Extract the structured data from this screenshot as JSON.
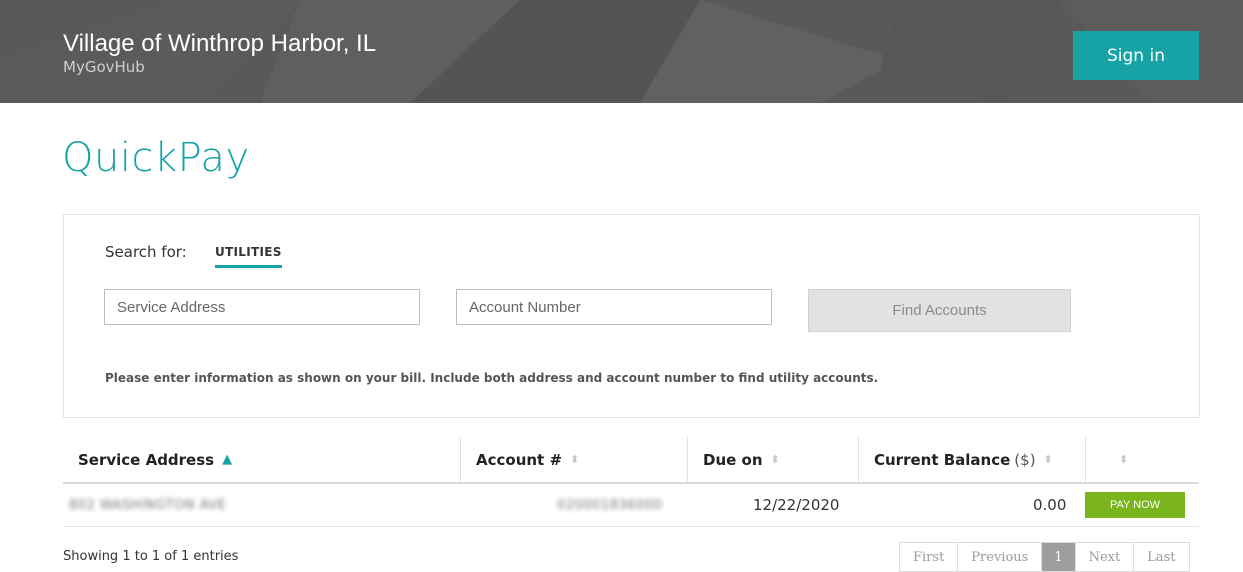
{
  "header": {
    "title": "Village of Winthrop Harbor, IL",
    "subtitle": "MyGovHub",
    "signin_label": "Sign in"
  },
  "page": {
    "title": "QuickPay"
  },
  "search": {
    "search_for_label": "Search for:",
    "tab_label": "UTILITIES",
    "address_placeholder": "Service Address",
    "account_placeholder": "Account Number",
    "find_label": "Find Accounts",
    "hint": "Please enter information as shown on your bill. Include both address and account number to find utility accounts."
  },
  "table": {
    "columns": {
      "address": "Service Address",
      "account": "Account #",
      "due": "Due on",
      "balance": "Current Balance",
      "balance_unit": "($)"
    },
    "rows": [
      {
        "address": "802 WASHINGTON AVE",
        "account": "020001836000",
        "due": "12/22/2020",
        "balance": "0.00",
        "action": "PAY NOW"
      }
    ]
  },
  "footer": {
    "info": "Showing 1 to 1 of 1 entries",
    "pager": {
      "first": "First",
      "previous": "Previous",
      "current": "1",
      "next": "Next",
      "last": "Last"
    }
  },
  "colors": {
    "accent": "#17a2a6",
    "pay": "#7ab51d",
    "header_bg": "#595959"
  }
}
